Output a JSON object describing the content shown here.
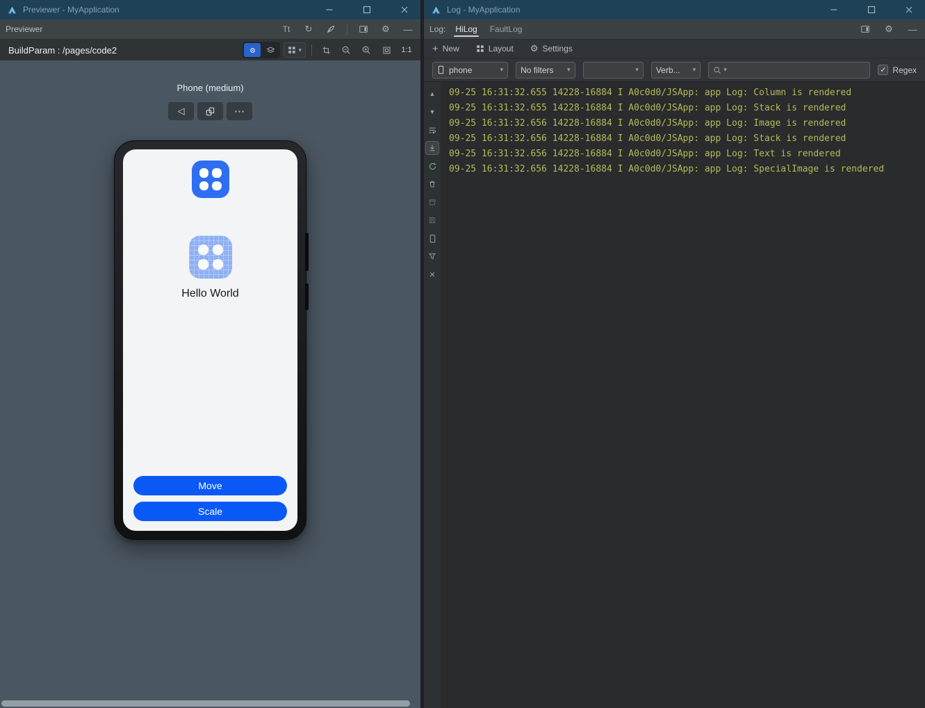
{
  "colors": {
    "titlebar_bg": "#1e4156",
    "canvas_bg": "#4a5661",
    "accent_blue": "#0a59f7",
    "icon_blue": "#2e6ff2",
    "log_text": "#b6bb55",
    "resume_green": "#5fb368"
  },
  "previewer": {
    "window_title": "Previewer - MyApplication",
    "tab_label": "Previewer",
    "build_param": "BuildParam : /pages/code2",
    "zoom_ratio": "1:1",
    "device_label": "Phone (medium)",
    "phone_app": {
      "hello_text": "Hello World",
      "move_button": "Move",
      "scale_button": "Scale"
    }
  },
  "log": {
    "window_title": "Log - MyApplication",
    "panel_label": "Log:",
    "tabs": [
      {
        "label": "HiLog",
        "active": true
      },
      {
        "label": "FaultLog",
        "active": false
      }
    ],
    "actions": {
      "new": "New",
      "layout": "Layout",
      "settings": "Settings"
    },
    "filters": {
      "device": "phone",
      "filter": "No filters",
      "process": "",
      "level": "Verb...",
      "search_value": "",
      "regex_label": "Regex",
      "regex_checked": true
    },
    "entries": [
      "09-25 16:31:32.655 14228-16884 I A0c0d0/JSApp: app Log: Column is rendered",
      "09-25 16:31:32.655 14228-16884 I A0c0d0/JSApp: app Log: Stack is rendered",
      "09-25 16:31:32.656 14228-16884 I A0c0d0/JSApp: app Log: Image is rendered",
      "09-25 16:31:32.656 14228-16884 I A0c0d0/JSApp: app Log: Stack is rendered",
      "09-25 16:31:32.656 14228-16884 I A0c0d0/JSApp: app Log: Text is rendered",
      "09-25 16:31:32.656 14228-16884 I A0c0d0/JSApp: app Log: SpecialImage is rendered"
    ]
  }
}
